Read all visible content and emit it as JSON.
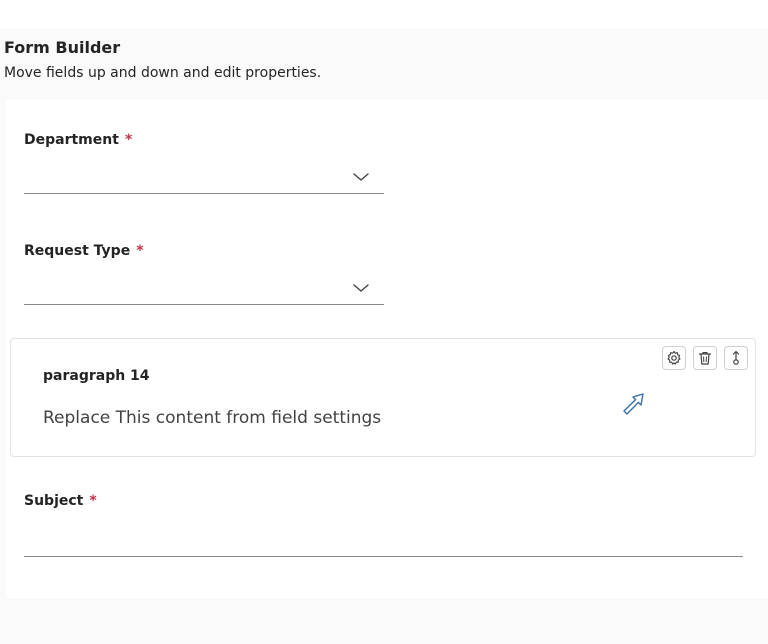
{
  "header": {
    "title": "Form Builder",
    "subtitle": "Move fields up and down and edit properties."
  },
  "fields": {
    "department": {
      "label": "Department",
      "required_mark": "*",
      "value": "",
      "icon": "chevron-down-icon"
    },
    "request_type": {
      "label": "Request Type",
      "required_mark": "*",
      "value": "",
      "icon": "chevron-down-icon"
    },
    "paragraph": {
      "title": "paragraph 14",
      "body": "Replace This content from field settings",
      "actions": [
        "gear-icon",
        "trash-icon",
        "drag-handle-icon"
      ]
    },
    "subject": {
      "label": "Subject",
      "required_mark": "*",
      "value": ""
    }
  },
  "colors": {
    "required": "#c4314b",
    "cursor": "#3a6fa8",
    "underline": "#8a8a8a",
    "page_bg": "#fafafa"
  }
}
